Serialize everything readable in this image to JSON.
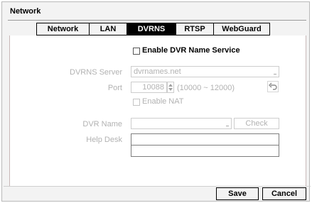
{
  "window": {
    "title": "Network"
  },
  "tabs": [
    {
      "label": "Network",
      "active": false
    },
    {
      "label": "LAN",
      "active": false
    },
    {
      "label": "DVRNS",
      "active": true
    },
    {
      "label": "RTSP",
      "active": false
    },
    {
      "label": "WebGuard",
      "active": false
    }
  ],
  "form": {
    "enable_dvrns": {
      "label": "Enable DVR Name Service",
      "checked": false
    },
    "dvrns_server": {
      "label": "DVRNS Server",
      "value": "dvrnames.net",
      "enabled": false
    },
    "port": {
      "label": "Port",
      "value": "10088",
      "range": "(10000 ~ 12000)",
      "enabled": false
    },
    "enable_nat": {
      "label": "Enable NAT",
      "checked": false,
      "enabled": false
    },
    "dvr_name": {
      "label": "DVR Name",
      "value": "",
      "check_label": "Check",
      "enabled": false
    },
    "help_desk": {
      "label": "Help Desk",
      "line1": "",
      "line2": ""
    }
  },
  "footer": {
    "save_label": "Save",
    "cancel_label": "Cancel"
  },
  "icons": {
    "undo": "undo-arrow-icon",
    "spin": "spinner-arrows-icon",
    "keyboard": "keyboard-indicator-icon"
  },
  "colors": {
    "active_tab_bg": "#000000",
    "disabled_text": "#b2b2b2"
  }
}
